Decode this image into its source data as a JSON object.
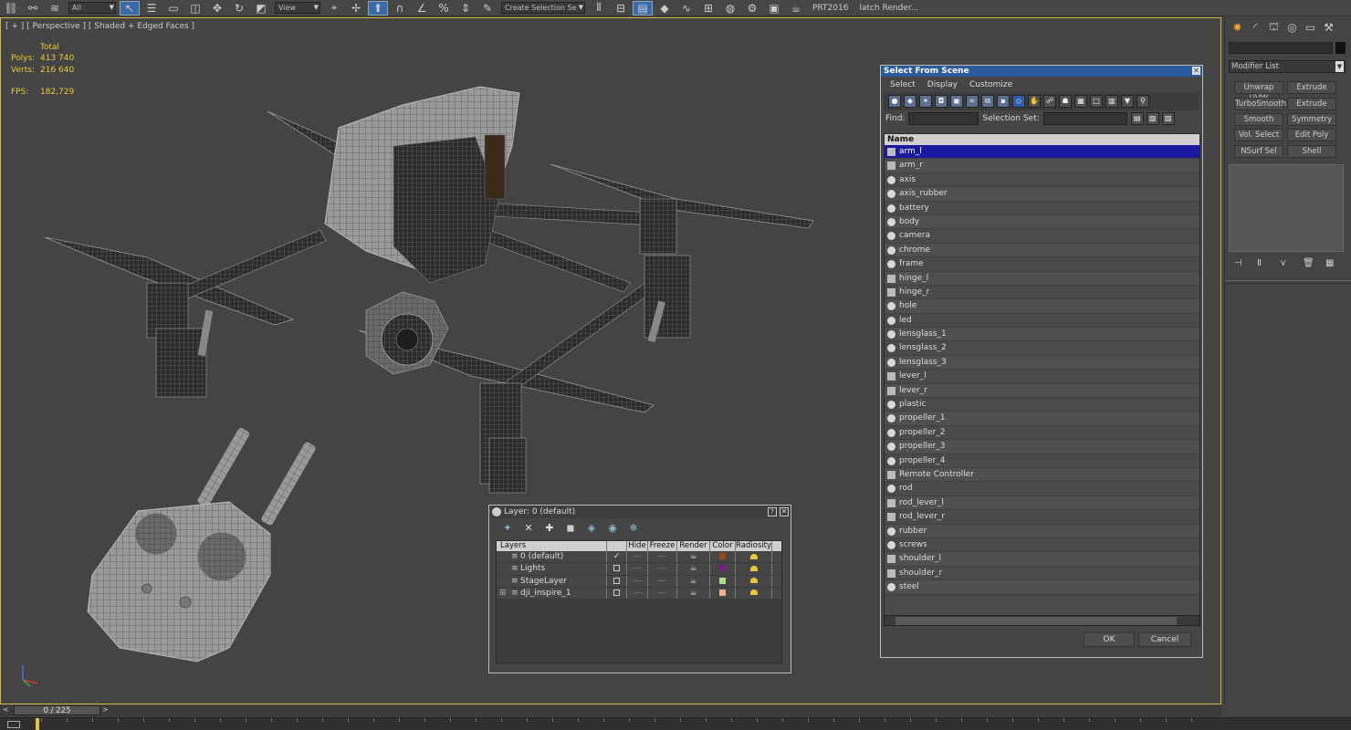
{
  "toolbar": {
    "selection_filter": "All",
    "ref_coord": "View",
    "selection_set_placeholder": "Create Selection Se",
    "label_prt": "PRT2016",
    "label_batch": "latch Render..."
  },
  "viewport": {
    "label": "[ + ] [ Perspective ] [ Shaded + Edged Faces ]",
    "stats": {
      "total_label": "Total",
      "polys_label": "Polys:",
      "polys_value": "413 740",
      "verts_label": "Verts:",
      "verts_value": "216 640",
      "fps_label": "FPS:",
      "fps_value": "182,729"
    }
  },
  "select_from_scene": {
    "title": "Select From Scene",
    "menu": [
      "Select",
      "Display",
      "Customize"
    ],
    "find_label": "Find:",
    "selection_set_label": "Selection Set:",
    "column_name": "Name",
    "items": [
      {
        "name": "arm_l",
        "icon": "group",
        "selected": true
      },
      {
        "name": "arm_r",
        "icon": "group"
      },
      {
        "name": "axis",
        "icon": "object"
      },
      {
        "name": "axis_rubber",
        "icon": "object"
      },
      {
        "name": "battery",
        "icon": "object"
      },
      {
        "name": "body",
        "icon": "object"
      },
      {
        "name": "camera",
        "icon": "object"
      },
      {
        "name": "chrome",
        "icon": "object"
      },
      {
        "name": "frame",
        "icon": "object"
      },
      {
        "name": "hinge_l",
        "icon": "group"
      },
      {
        "name": "hinge_r",
        "icon": "group"
      },
      {
        "name": "hole",
        "icon": "object"
      },
      {
        "name": "led",
        "icon": "object"
      },
      {
        "name": "lensglass_1",
        "icon": "object"
      },
      {
        "name": "lensglass_2",
        "icon": "object"
      },
      {
        "name": "lensglass_3",
        "icon": "object"
      },
      {
        "name": "lever_l",
        "icon": "group"
      },
      {
        "name": "lever_r",
        "icon": "group"
      },
      {
        "name": "plastic",
        "icon": "object"
      },
      {
        "name": "propeller_1",
        "icon": "object"
      },
      {
        "name": "propeller_2",
        "icon": "object"
      },
      {
        "name": "propeller_3",
        "icon": "object"
      },
      {
        "name": "propeller_4",
        "icon": "object"
      },
      {
        "name": "Remote Controller",
        "icon": "group"
      },
      {
        "name": "rod",
        "icon": "object"
      },
      {
        "name": "rod_lever_l",
        "icon": "group"
      },
      {
        "name": "rod_lever_r",
        "icon": "group"
      },
      {
        "name": "rubber",
        "icon": "object"
      },
      {
        "name": "screws",
        "icon": "object"
      },
      {
        "name": "shoulder_l",
        "icon": "group"
      },
      {
        "name": "shoulder_r",
        "icon": "group"
      },
      {
        "name": "steel",
        "icon": "object"
      }
    ],
    "ok_label": "OK",
    "cancel_label": "Cancel"
  },
  "layer_dialog": {
    "title": "Layer: 0 (default)",
    "columns": [
      "Layers",
      "Hide",
      "Freeze",
      "Render",
      "Color",
      "Radiosity"
    ],
    "rows": [
      {
        "name": "0 (default)",
        "active": true,
        "color": "#9a4a1a",
        "expand": false
      },
      {
        "name": "Lights",
        "active": false,
        "color": "#7a1a8a",
        "expand": false
      },
      {
        "name": "StageLayer",
        "active": false,
        "color": "#a8e08a",
        "expand": false
      },
      {
        "name": "dji_inspire_1",
        "active": false,
        "color": "#f0b090",
        "expand": true
      }
    ]
  },
  "command_panel": {
    "modifier_list_label": "Modifier List",
    "buttons": [
      "Unwrap UVW",
      "Extrude",
      "TurboSmooth",
      "Extrude",
      "Smooth",
      "Symmetry",
      "Vol. Select",
      "Edit Poly",
      "NSurf Sel",
      "Shell"
    ]
  },
  "timeline": {
    "frame_label": "0 / 225",
    "prev": "<",
    "next": ">"
  }
}
